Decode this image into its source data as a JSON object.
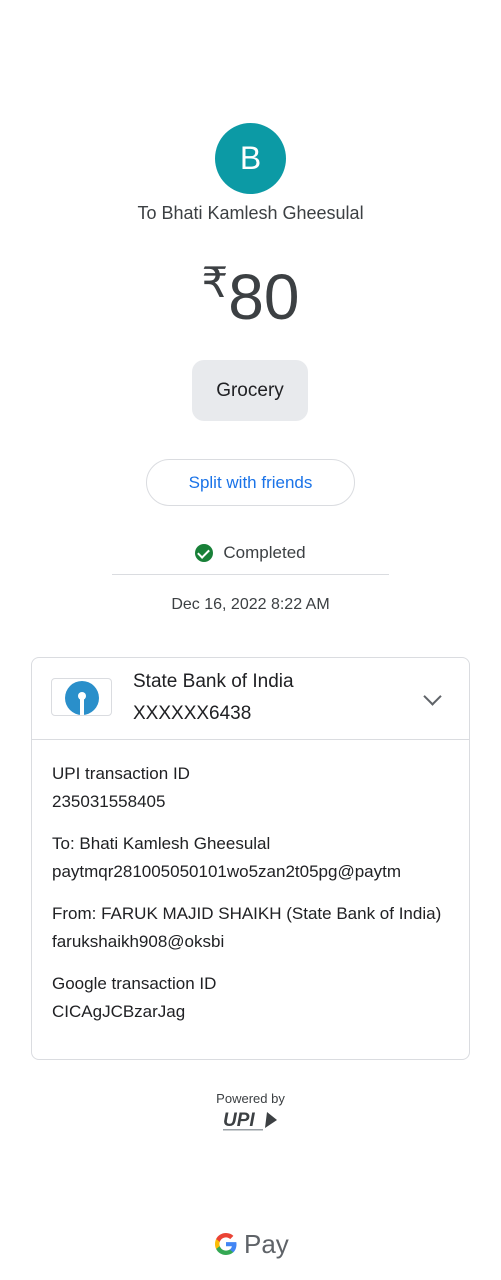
{
  "recipient": {
    "avatar_initial": "B",
    "to_label": "To Bhati Kamlesh Gheesulal"
  },
  "amount": {
    "currency_symbol": "₹",
    "value": "80"
  },
  "note": "Grocery",
  "split_button_label": "Split with friends",
  "status": {
    "label": "Completed",
    "color": "#188038"
  },
  "datetime": "Dec 16, 2022 8:22 AM",
  "bank": {
    "name": "State Bank of India",
    "account": "XXXXXX6438",
    "logo_icon": "sbi-logo",
    "expand_icon": "chevron-down-icon"
  },
  "details": [
    {
      "label": "UPI transaction ID",
      "value": "235031558405"
    },
    {
      "label": "To: Bhati Kamlesh Gheesulal",
      "value": "paytmqr281005050101wo5zan2t05pg@paytm"
    },
    {
      "label": "From: FARUK MAJID SHAIKH (State Bank of India)",
      "value": "farukshaikh908@oksbi"
    },
    {
      "label": "Google transaction ID",
      "value": "CICAgJCBzarJag"
    }
  ],
  "footer": {
    "powered_by": "Powered by",
    "upi_logo_text": "UPI",
    "brand_pay": "Pay"
  },
  "colors": {
    "avatar_bg": "#0c9aa5",
    "link_blue": "#1a73e8",
    "chip_bg": "#e8eaed"
  }
}
